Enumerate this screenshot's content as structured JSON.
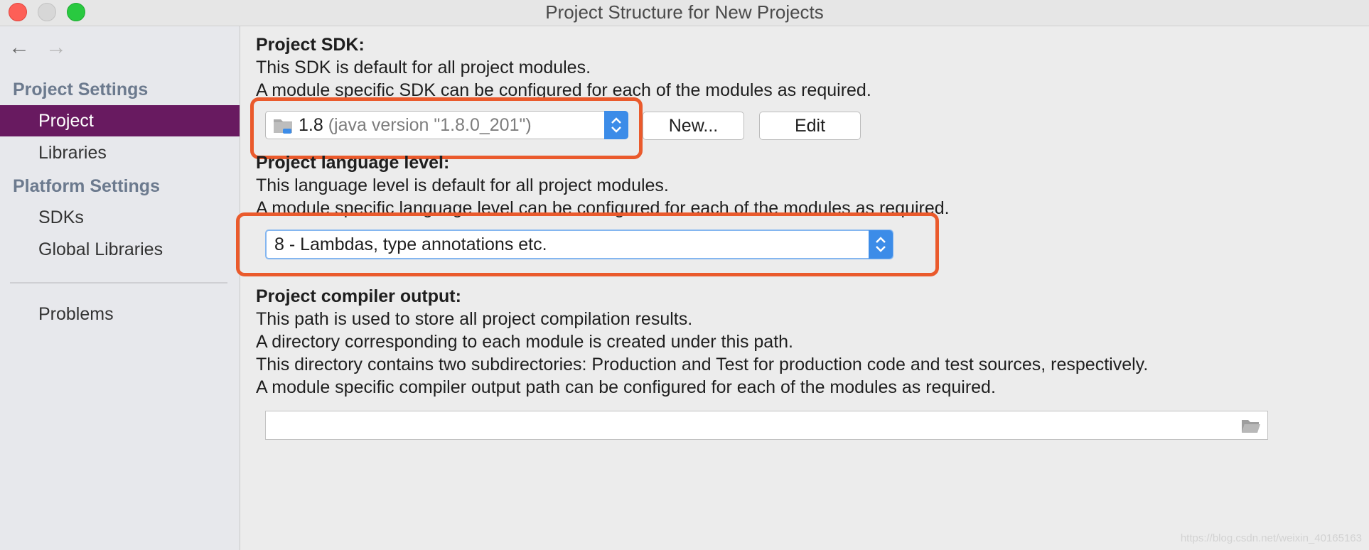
{
  "window": {
    "title": "Project Structure for New Projects"
  },
  "nav": {
    "back_icon": "arrow-left-icon",
    "forward_icon": "arrow-right-icon"
  },
  "sidebar": {
    "project_settings_header": "Project Settings",
    "platform_settings_header": "Platform Settings",
    "items": [
      {
        "label": "Project",
        "selected": true
      },
      {
        "label": "Libraries",
        "selected": false
      },
      {
        "label": "SDKs",
        "selected": false
      },
      {
        "label": "Global Libraries",
        "selected": false
      },
      {
        "label": "Problems",
        "selected": false
      }
    ],
    "selected_color": "#681a60"
  },
  "sdk": {
    "heading": "Project SDK:",
    "line1": "This SDK is default for all project modules.",
    "line2": "A module specific SDK can be configured for each of the modules as required.",
    "selected_value": "1.8",
    "selected_detail": "(java version \"1.8.0_201\")",
    "new_button": "New...",
    "edit_button": "Edit"
  },
  "language": {
    "heading": "Project language level:",
    "line1": "This language level is default for all project modules.",
    "line2": "A module specific language level can be configured for each of the modules as required.",
    "selected_value": "8 - Lambdas, type annotations etc."
  },
  "compiler": {
    "heading": "Project compiler output:",
    "line1": "This path is used to store all project compilation results.",
    "line2": "A directory corresponding to each module is created under this path.",
    "line3": "This directory contains two subdirectories: Production and Test for production code and test sources, respectively.",
    "line4": "A module specific compiler output path can be configured for each of the modules as required.",
    "path_value": ""
  },
  "colors": {
    "accent_blue": "#3c8ce8",
    "callout_orange": "#ea5a2c"
  },
  "watermark": "https://blog.csdn.net/weixin_40165163"
}
